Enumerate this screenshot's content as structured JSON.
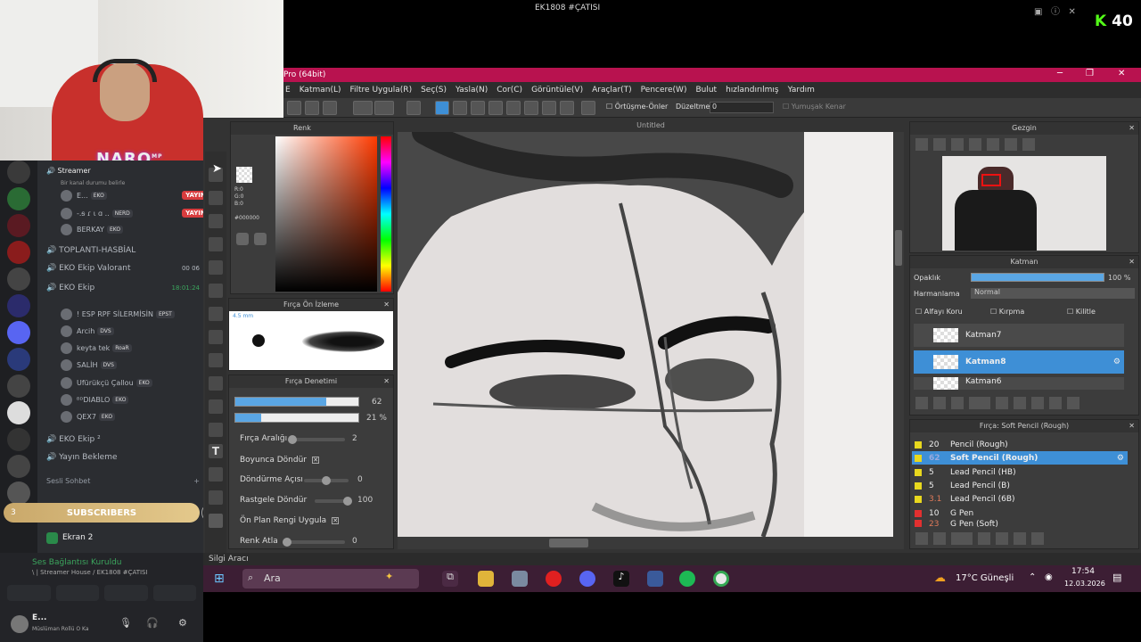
{
  "stream": {
    "title": "EK1808 #ÇATISI",
    "viewers": "40",
    "kick_letter": "K"
  },
  "webcam": {
    "logo": "NARO",
    "logo_sub": "MP"
  },
  "discord": {
    "status_header": "Streamer",
    "status_sub": "Bir kanal durumu belirle",
    "members": [
      {
        "name": "E...",
        "tag": "EKO",
        "live": "YAYINDA"
      },
      {
        "name": "-.ᵴ ɾ ι ɑ ..",
        "tag": "NERD",
        "live": "YAYINDA"
      },
      {
        "name": "BERKAY",
        "tag": "EKO"
      }
    ],
    "channels": [
      {
        "name": "TOPLANTI-HASBİAL"
      },
      {
        "name": "EKO Ekip Valorant",
        "meta": "00 06"
      },
      {
        "name": "EKO Ekip",
        "meta": "18:01:24"
      }
    ],
    "ekip_members": [
      {
        "name": "! ESP RPF SİLERMİSİN",
        "tag": "EPST"
      },
      {
        "name": "Arcih",
        "tag": "DVS"
      },
      {
        "name": "keyta tek",
        "tag": "RoaR"
      },
      {
        "name": "SALİH",
        "tag": "DVS"
      },
      {
        "name": "Ufürükçü Çallou",
        "tag": "EKO"
      },
      {
        "name": "ᴮᴰDIABLO",
        "tag": "EKO"
      },
      {
        "name": "QEX7",
        "tag": "EKO"
      }
    ],
    "channels2": [
      {
        "name": "EKO Ekip ²"
      },
      {
        "name": "Yayın Bekleme"
      }
    ],
    "voice_section": "Sesli Sohbet",
    "screen": "Ekran 2",
    "voice_status": "Ses Bağlantısı Kuruldu",
    "voice_channel": "\\ | Streamer House / EK1808 #ÇATISI",
    "user": "E...",
    "user_sub": "Müslüman Rollü O Ka"
  },
  "subscribers": {
    "label": "SUBSCRIBERS",
    "left": "3",
    "right": "4"
  },
  "app": {
    "title": "Pro (64bit)",
    "menus": [
      "Katman(L)",
      "Filtre Uygula(R)",
      "Seç(S)",
      "Yasla(N)",
      "Cor(C)",
      "Görüntüle(V)",
      "Araçlar(T)",
      "Pencere(W)",
      "Bulut",
      "hızlandırılmış",
      "Yardım"
    ],
    "menu_e": "E",
    "toolbar": {
      "overlap": "Örtüşme-Önler",
      "correction": "Düzeltme",
      "correction_val": "0",
      "soft_edge": "Yumuşak Kenar"
    },
    "canvas_title": "Untitled",
    "color_panel": {
      "title": "Renk",
      "r": "R:0",
      "g": "G:0",
      "b": "B:0",
      "hex": "#000000"
    },
    "brush_preview": {
      "title": "Fırça Ön İzleme",
      "size": "4.5 mm"
    },
    "brush_control": {
      "title": "Fırça Denetimi",
      "size_val": "62",
      "size_pct": 0.74,
      "opacity_val": "21 %",
      "opacity_pct": 0.21,
      "spacing_label": "Fırça Aralığı",
      "spacing_val": "2",
      "follow_label": "Boyunca Döndür",
      "rotation_label": "Döndürme Açısı",
      "rotation_val": "0",
      "random_rot_label": "Rastgele Döndür",
      "random_rot_val": "100",
      "fore_color_label": "Ön Plan Rengi Uygula",
      "color_jump_label": "Renk Atla",
      "color_jump_val": "0"
    },
    "navigator": {
      "title": "Gezgin"
    },
    "layers": {
      "title": "Katman",
      "opacity_label": "Opaklık",
      "opacity_val": "100 %",
      "blend_label": "Harmanlama",
      "blend_val": "Normal",
      "protect_alpha": "Alfayı Koru",
      "clipping": "Kırpma",
      "lock": "Kilitle",
      "items": [
        {
          "name": "Katman7"
        },
        {
          "name": "Katman8",
          "selected": true
        },
        {
          "name": "Katman6"
        }
      ]
    },
    "brushes": {
      "title": "Fırça: Soft Pencil (Rough)",
      "items": [
        {
          "size": "20",
          "name": "Pencil (Rough)",
          "color": "#e8d81e"
        },
        {
          "size": "62",
          "name": "Soft Pencil (Rough)",
          "color": "#e8d81e",
          "selected": true
        },
        {
          "size": "5",
          "name": "Lead Pencil (HB)",
          "color": "#e8d81e"
        },
        {
          "size": "5",
          "name": "Lead Pencil (B)",
          "color": "#e8d81e"
        },
        {
          "size": "3.1",
          "name": "Lead Pencil (6B)",
          "color": "#e8d81e"
        },
        {
          "size": "10",
          "name": "G Pen",
          "color": "#e23030"
        },
        {
          "size": "23",
          "name": "G Pen (Soft)",
          "color": "#e23030"
        }
      ]
    },
    "status": "Silgi Aracı"
  },
  "taskbar": {
    "search": "Ara",
    "weather": "17°C  Güneşli",
    "time": "17:54",
    "date": "12.03.2026"
  }
}
